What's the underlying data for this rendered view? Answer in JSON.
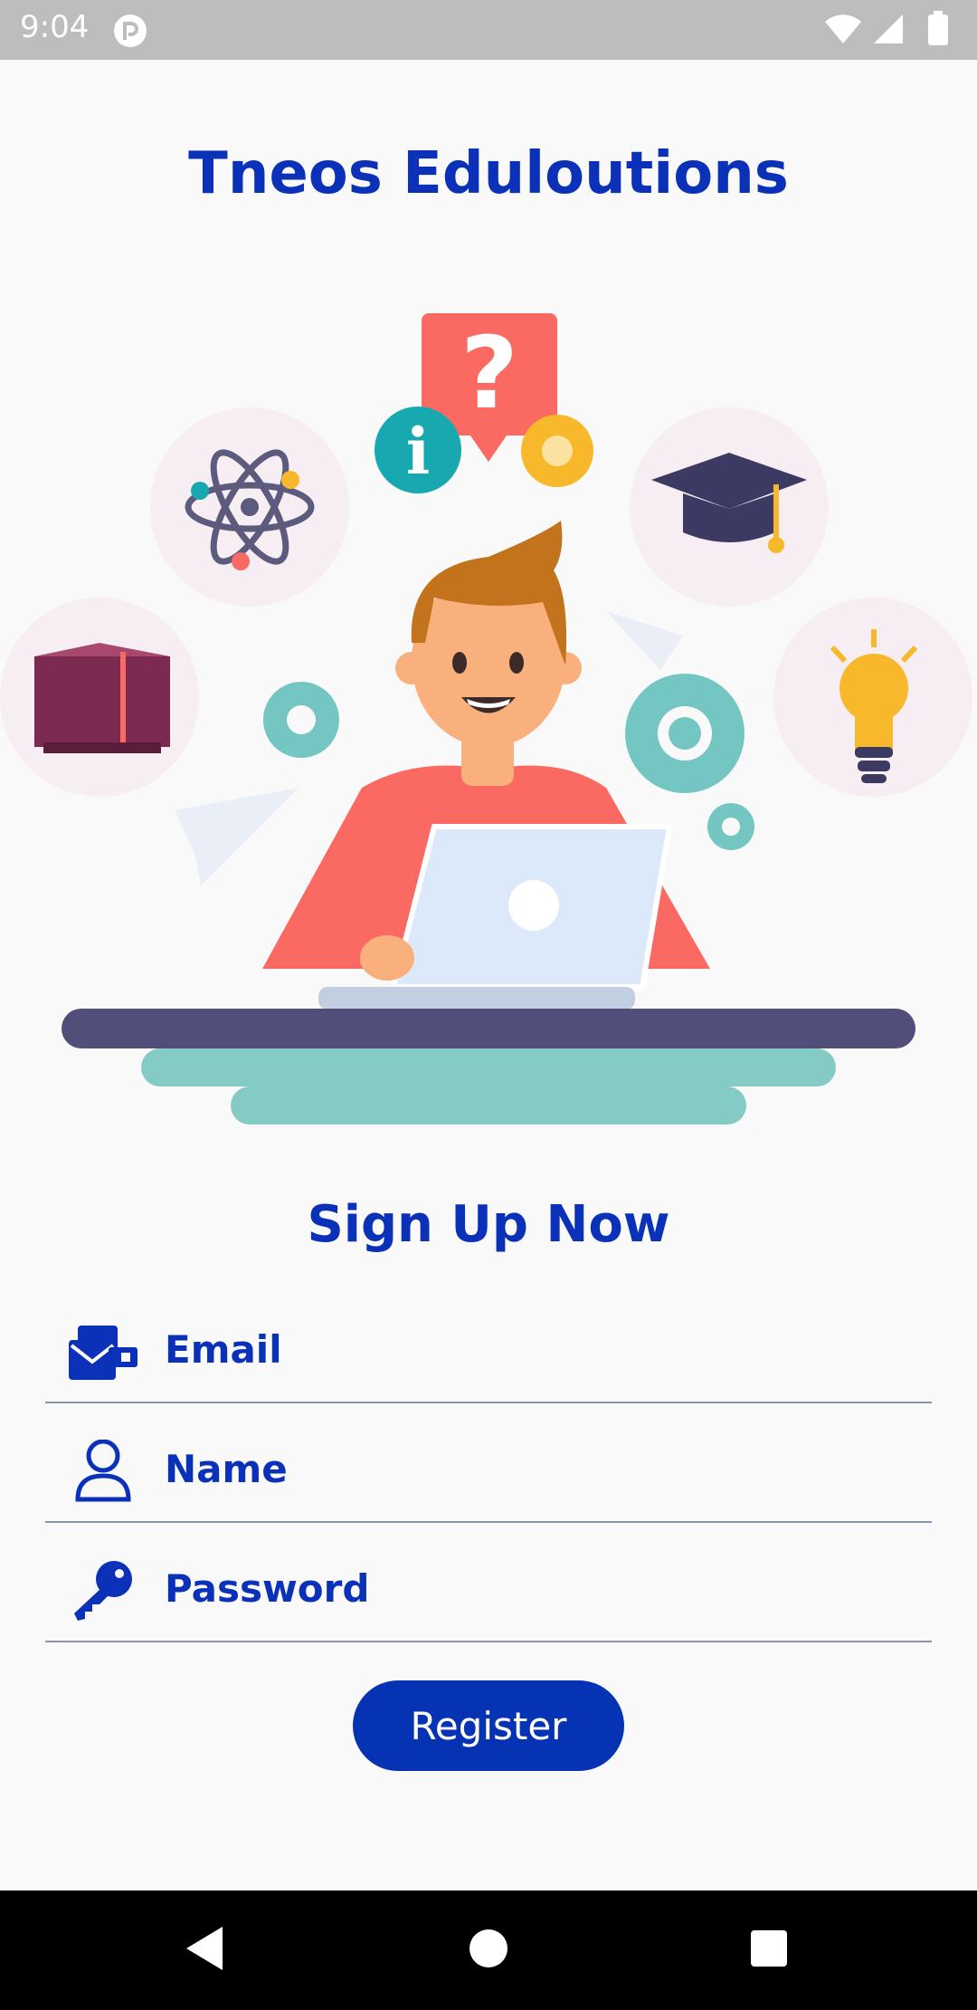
{
  "status_bar": {
    "time": "9:04",
    "icons": [
      "app-notification-icon",
      "wifi-icon",
      "signal-icon",
      "battery-icon"
    ]
  },
  "header": {
    "title": "Tneos Eduloutions"
  },
  "illustration": {
    "name": "student-with-laptop",
    "palette": {
      "shirt": "#fa6a63",
      "table": "#524e7a",
      "base": "#84cbc5",
      "gear": "#74c6c2",
      "laptop": "#dce9fa"
    }
  },
  "form": {
    "title": "Sign Up Now",
    "fields": [
      {
        "label": "Email",
        "icon": "email-icon"
      },
      {
        "label": "Name",
        "icon": "user-icon"
      },
      {
        "label": "Password",
        "icon": "key-icon"
      }
    ],
    "submit_label": "Register"
  },
  "nav_bar": {
    "items": [
      "back-icon",
      "home-icon",
      "recents-icon"
    ]
  },
  "colors": {
    "accent": "#0b31b8",
    "button": "#0533b3",
    "status_bar": "#bdbdbd",
    "background": "#f9f9f9"
  }
}
